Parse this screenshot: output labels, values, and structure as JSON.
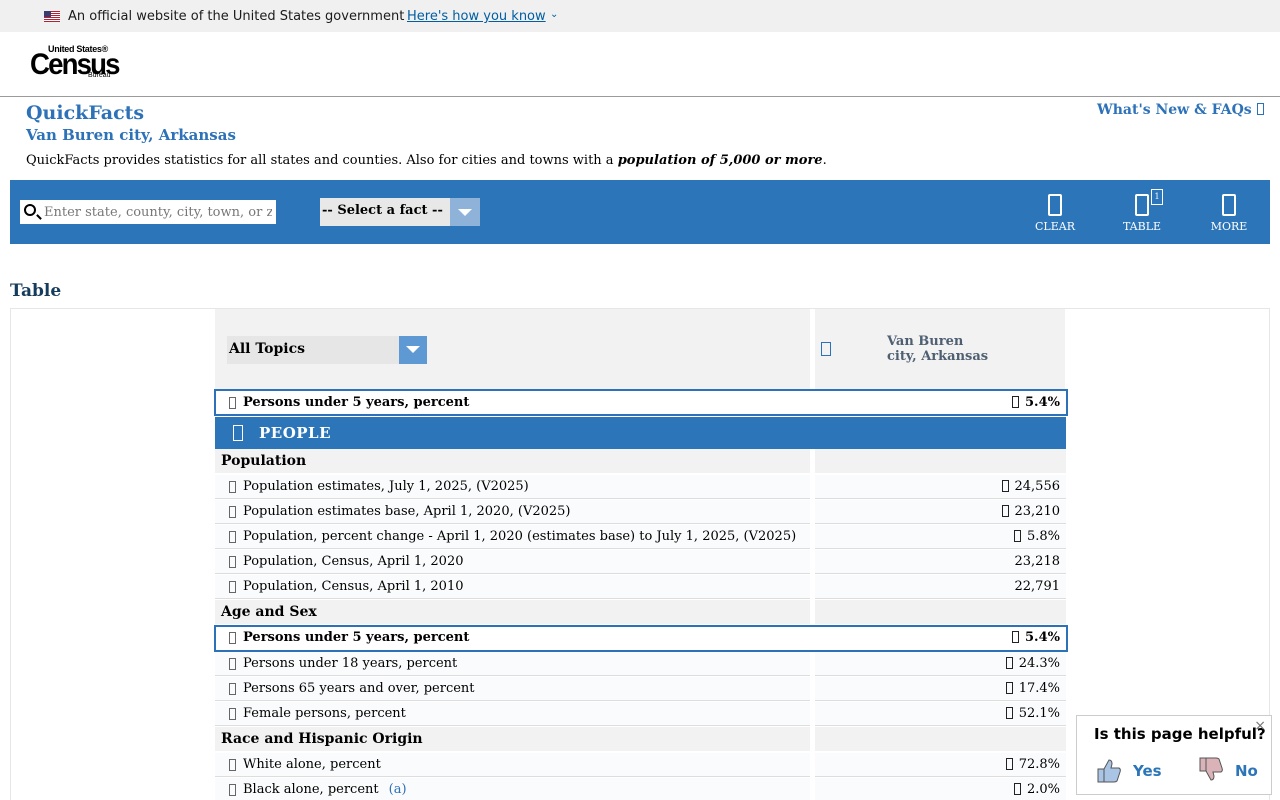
{
  "gov_banner": {
    "text": "An official website of the United States government",
    "link": "Here's how you know",
    "chevron": "⌄"
  },
  "logo": {
    "line1": "United States®",
    "line2": "Census",
    "line3": "Bureau"
  },
  "title": {
    "main": "QuickFacts",
    "location": "Van Buren city, Arkansas",
    "desc_prefix": "QuickFacts provides statistics for all states and counties. Also for cities and towns with a ",
    "desc_emphasis": "population of 5,000 or more",
    "desc_suffix": ".",
    "whats_new": "What's New & FAQs "
  },
  "toolbar": {
    "search_placeholder": "Enter state, county, city, town, or zip code",
    "fact_select": "-- Select a fact --",
    "clear": "CLEAR",
    "table": "TABLE",
    "table_badge": "1",
    "more": "MORE"
  },
  "table": {
    "heading": "Table",
    "topics": "All Topics",
    "location_header_line1": "Van Buren",
    "location_header_line2": "city, Arkansas",
    "pinned_fact": {
      "label": "Persons under 5 years, percent",
      "value": "5.4%"
    },
    "section": "PEOPLE",
    "categories": {
      "population": "Population",
      "age_sex": "Age and Sex",
      "race": "Race and Hispanic Origin"
    },
    "population_rows": [
      {
        "label": "Population estimates, July 1, 2025, (V2025)",
        "value": "24,556"
      },
      {
        "label": "Population estimates base, April 1, 2020, (V2025)",
        "value": "23,210"
      },
      {
        "label": "Population, percent change - April 1, 2020 (estimates base) to July 1, 2025, (V2025)",
        "value": "5.8%"
      },
      {
        "label": "Population, Census, April 1, 2020",
        "value": "23,218"
      },
      {
        "label": "Population, Census, April 1, 2010",
        "value": "22,791"
      }
    ],
    "age_rows": [
      {
        "label": "Persons under 5 years, percent",
        "value": "5.4%"
      },
      {
        "label": "Persons under 18 years, percent",
        "value": "24.3%"
      },
      {
        "label": "Persons 65 years and over, percent",
        "value": "17.4%"
      },
      {
        "label": "Female persons, percent",
        "value": "52.1%"
      }
    ],
    "race_rows": [
      {
        "label": "White alone, percent",
        "value": "72.8%"
      },
      {
        "label": "Black alone, percent",
        "value": "2.0%",
        "footnote": "(a)"
      }
    ]
  },
  "feedback": {
    "question": "Is this page helpful?",
    "yes": "Yes",
    "no": "No",
    "close": "×"
  }
}
